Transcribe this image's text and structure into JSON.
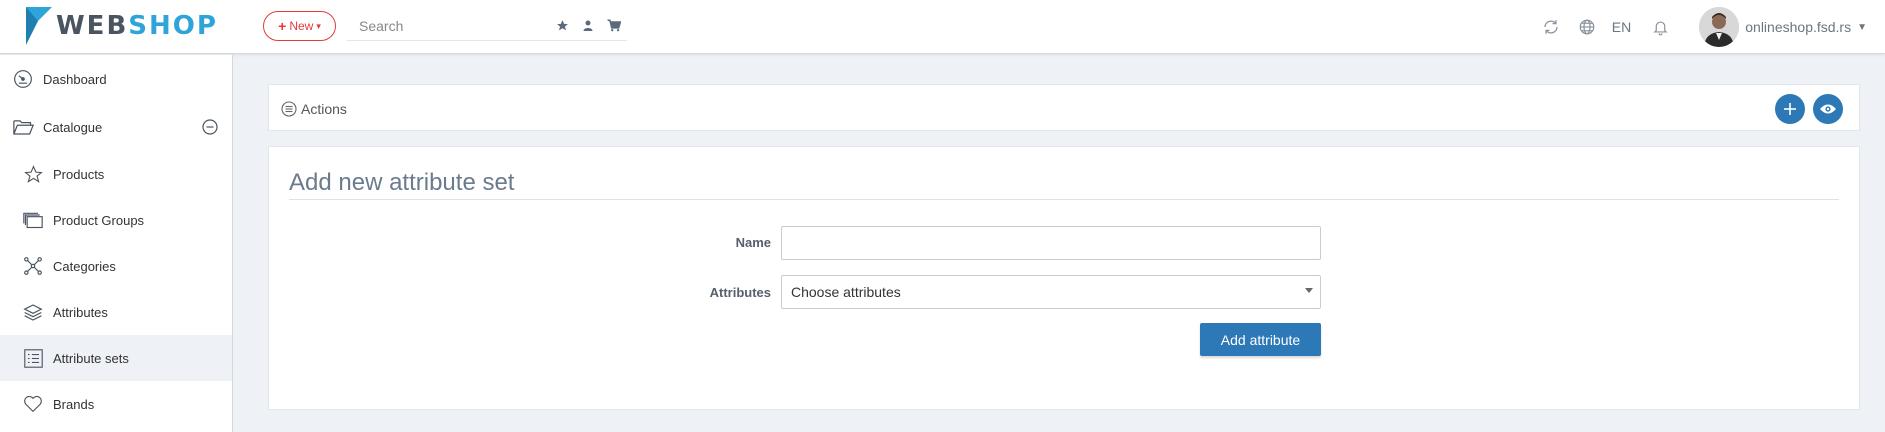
{
  "brand": {
    "part1": "WEB",
    "part2": "SHOP",
    "accent": "#2fa4d9"
  },
  "header": {
    "new_button_label": "New",
    "search_placeholder": "Search",
    "search_icons": [
      "star-icon",
      "user-icon",
      "cart-icon"
    ],
    "tools": [
      "refresh-icon",
      "globe-icon"
    ],
    "language": "EN",
    "notification_icon": "bell-icon",
    "user_name": "onlineshop.fsd.rs"
  },
  "sidebar": {
    "items": [
      {
        "label": "Dashboard",
        "icon": "dashboard-icon"
      },
      {
        "label": "Catalogue",
        "icon": "folder-open-icon",
        "expanded": true
      },
      {
        "label": "Products",
        "icon": "star-outline-icon"
      },
      {
        "label": "Product Groups",
        "icon": "stack-icon"
      },
      {
        "label": "Categories",
        "icon": "nodes-icon"
      },
      {
        "label": "Attributes",
        "icon": "layers-icon"
      },
      {
        "label": "Attribute sets",
        "icon": "list-icon",
        "active": true
      },
      {
        "label": "Brands",
        "icon": "heart-icon"
      }
    ]
  },
  "actions": {
    "label": "Actions",
    "buttons": [
      "plus-icon",
      "eye-icon"
    ]
  },
  "form": {
    "title": "Add new attribute set",
    "name_label": "Name",
    "name_value": "",
    "attributes_label": "Attributes",
    "attributes_placeholder": "Choose attributes",
    "submit_label": "Add attribute"
  },
  "colors": {
    "primary": "#2d78b6",
    "danger": "#e33b3b",
    "background": "#eef1f5"
  }
}
